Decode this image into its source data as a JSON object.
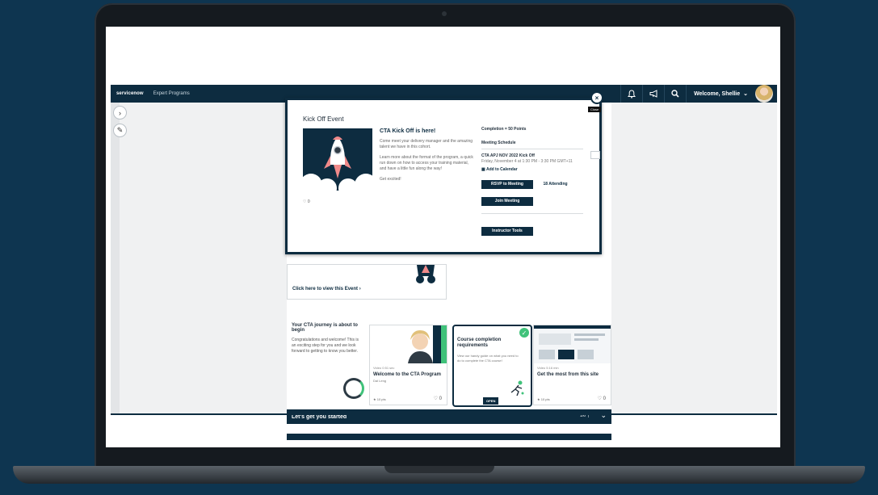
{
  "header": {
    "brand": "servicenow",
    "program": "Expert Programs",
    "welcome": "Welcome, Shellie"
  },
  "modal": {
    "title": "Kick Off Event",
    "event_heading": "CTA Kick Off is here!",
    "description": [
      "Come meet your delivery manager and the amazing talent we have in this cohort.",
      "Learn more about the format of the program, a quick run down on how to access your training material, and have a little fun along the way!",
      "Get excited!"
    ],
    "likes": "0",
    "completion": "Completion = 50 Points",
    "schedule_title": "Meeting Schedule",
    "meeting_name": "CTA APJ NOV 2022 Kick Off",
    "meeting_time": "Friday, November 4 at 1:30 PM - 3:30 PM GMT+11",
    "add_calendar": "Add to Calendar",
    "rsvp": "RSVP to Meeting",
    "attending": "18 Attending",
    "join": "Join Meeting",
    "instructor": "Instructor Tools",
    "close_tooltip": "Close"
  },
  "event_card": {
    "link": "Click here to view this Event"
  },
  "journey": {
    "title": "Your CTA journey is about to begin",
    "body": "Congratulations and welcome! This is an exciting step for you and we look forward to getting to know you better."
  },
  "tiles": [
    {
      "meta": "Video 0:51 sec",
      "title": "Welcome to the CTA Program",
      "sub": "Dal Leng",
      "points": "10 pts",
      "likes": "0"
    },
    {
      "title": "Course completion requirements",
      "body": "View our handy guide on what you need to do to complete the CTA course!",
      "open": "OPEN"
    },
    {
      "meta": "Video 5:16 min",
      "title": "Get the most from this site",
      "points": "10 pts",
      "likes": "0"
    }
  ],
  "started": {
    "title": "Let's get you started",
    "page": "1/6"
  },
  "colors": {
    "navy": "#0d2c40",
    "green": "#40c27a",
    "background": "#0e3550"
  }
}
